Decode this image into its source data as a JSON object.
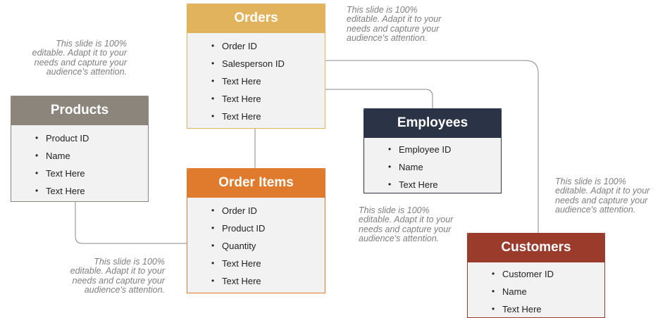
{
  "colors": {
    "orders": "#e1b35c",
    "products": "#8b857c",
    "employees": "#2b3447",
    "order_items": "#e07a2c",
    "customers": "#9a3b2c"
  },
  "entities": {
    "orders": {
      "title": "Orders",
      "items": [
        "Order ID",
        "Salesperson ID",
        "Text Here",
        "Text Here",
        "Text Here"
      ]
    },
    "products": {
      "title": "Products",
      "items": [
        "Product ID",
        "Name",
        "Text Here",
        "Text Here"
      ]
    },
    "employees": {
      "title": "Employees",
      "items": [
        "Employee ID",
        "Name",
        "Text Here"
      ]
    },
    "order_items": {
      "title": "Order Items",
      "items": [
        "Order ID",
        "Product ID",
        "Quantity",
        "Text Here",
        "Text Here"
      ]
    },
    "customers": {
      "title": "Customers",
      "items": [
        "Customer ID",
        "Name",
        "Text Here"
      ]
    }
  },
  "notes": {
    "top_left": [
      "This slide is 100%",
      "editable. Adapt it to your",
      "needs and capture your",
      "audience's attention."
    ],
    "top_right": [
      "This slide is 100%",
      "editable. Adapt it to your",
      "needs and capture your",
      "audience's attention."
    ],
    "middle_right": [
      "This slide is 100%",
      "editable. Adapt it to your",
      "needs and capture your",
      "audience's attention."
    ],
    "far_right": [
      "This slide is 100%",
      "editable. Adapt it to your",
      "needs and capture your",
      "audience's attention."
    ],
    "bottom_left": [
      "This slide is 100%",
      "editable. Adapt it to your",
      "needs and capture your",
      "audience's attention."
    ]
  }
}
